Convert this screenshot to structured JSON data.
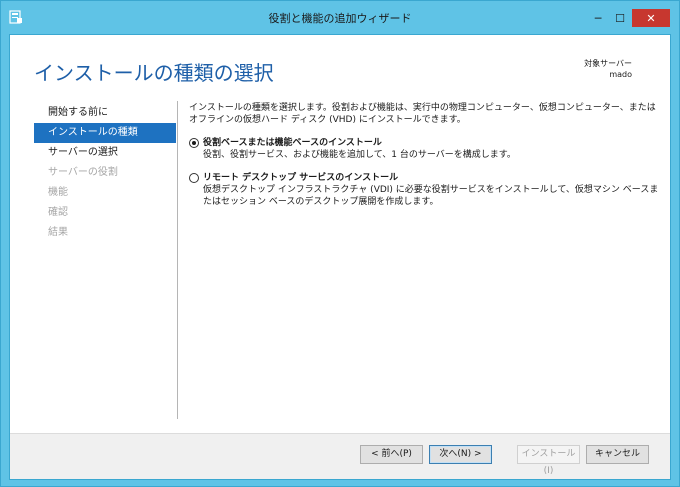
{
  "window": {
    "title": "役割と機能の追加ウィザード",
    "minimize_glyph": "─",
    "maximize_glyph": "☐",
    "close_glyph": "✕"
  },
  "header": {
    "page_title": "インストールの種類の選択",
    "target_server_label": "対象サーバー",
    "target_server_name": "mado"
  },
  "sidebar": {
    "items": [
      {
        "label": "開始する前に",
        "state": "normal"
      },
      {
        "label": "インストールの種類",
        "state": "active"
      },
      {
        "label": "サーバーの選択",
        "state": "normal"
      },
      {
        "label": "サーバーの役割",
        "state": "disabled"
      },
      {
        "label": "機能",
        "state": "disabled"
      },
      {
        "label": "確認",
        "state": "disabled"
      },
      {
        "label": "結果",
        "state": "disabled"
      }
    ]
  },
  "main": {
    "description": "インストールの種類を選択します。役割および機能は、実行中の物理コンピューター、仮想コンピューター、またはオフラインの仮想ハード ディスク (VHD) にインストールできます。",
    "options": [
      {
        "title": "役割ベースまたは機能ベースのインストール",
        "description": "役割、役割サービス、および機能を追加して、1 台のサーバーを構成します。",
        "checked": true
      },
      {
        "title": "リモート デスクトップ サービスのインストール",
        "description": "仮想デスクトップ インフラストラクチャ (VDI) に必要な役割サービスをインストールして、仮想マシン ベースまたはセッション ベースのデスクトップ展開を作成します。",
        "checked": false
      }
    ]
  },
  "footer": {
    "prev_label": "< 前へ(P)",
    "next_label": "次へ(N) >",
    "install_label": "インストール(I)",
    "cancel_label": "キャンセル"
  },
  "colors": {
    "titlebar": "#5fc3e6",
    "accent": "#1e72c1",
    "page_title": "#1e5fa8",
    "close_button": "#c7372f"
  }
}
